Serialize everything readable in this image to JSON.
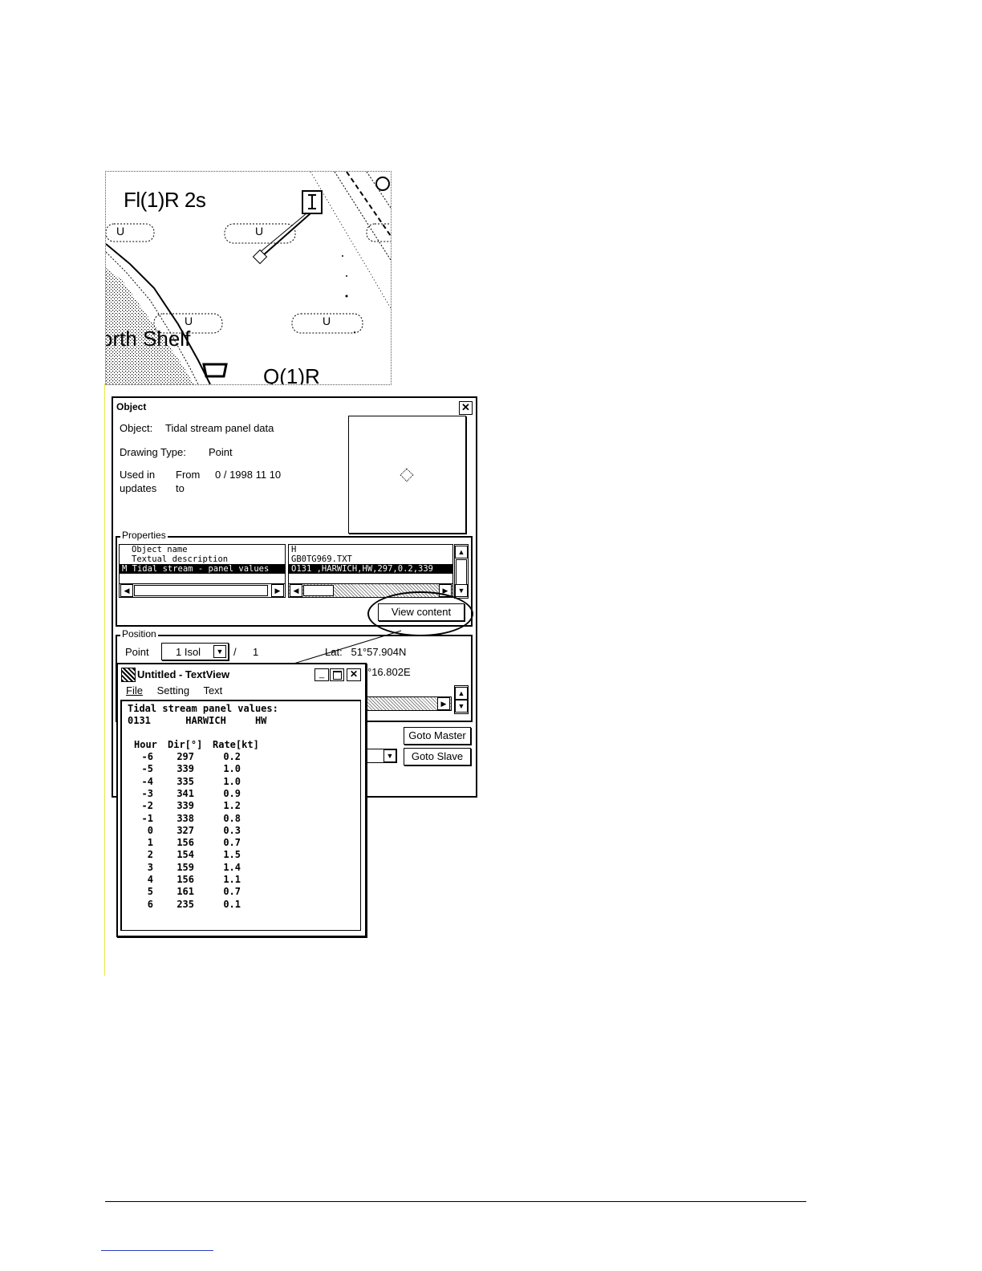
{
  "map": {
    "light_label": "Fl(1)R 2s",
    "area_label": "orth Shelf",
    "bottom_label": "Q(1)R",
    "buoy_mark": "U"
  },
  "object_dialog": {
    "title": "Object",
    "object_label": "Object:",
    "object_value": "Tidal stream panel data",
    "drawing_type_label": "Drawing Type:",
    "drawing_type_value": "Point",
    "used_in_label": "Used in",
    "updates_label": "updates",
    "from_label": "From",
    "to_label": "to",
    "from_value": "0 / 1998 11 10",
    "properties": {
      "label": "Properties",
      "names": [
        "Object name",
        "Textual description",
        "M Tidal stream - panel values"
      ],
      "values": [
        "H",
        "GB0TG969.TXT",
        "O131 ,HARWICH,HW,297,0.2,339"
      ],
      "view_content_button": "View content"
    },
    "position": {
      "label": "Position",
      "point_label": "Point",
      "point_select": "1 Isol",
      "slash": "/",
      "count": "1",
      "lat": "Lat:   51°57.904N",
      "lon": "°16.802E"
    },
    "goto_master": "Goto Master",
    "goto_slave": "Goto Slave"
  },
  "textview": {
    "title": "Untitled - TextView",
    "menu": [
      "File",
      "Setting",
      "Text"
    ],
    "heading": "Tidal stream panel values:",
    "location_line": "0131      HARWICH     HW",
    "columns": [
      "Hour",
      "Dir[°]",
      "Rate[kt]"
    ],
    "rows": [
      [
        "-6",
        "297",
        "0.2"
      ],
      [
        "-5",
        "339",
        "1.0"
      ],
      [
        "-4",
        "335",
        "1.0"
      ],
      [
        "-3",
        "341",
        "0.9"
      ],
      [
        "-2",
        "339",
        "1.2"
      ],
      [
        "-1",
        "338",
        "0.8"
      ],
      [
        "0",
        "327",
        "0.3"
      ],
      [
        "1",
        "156",
        "0.7"
      ],
      [
        "2",
        "154",
        "1.5"
      ],
      [
        "3",
        "159",
        "1.4"
      ],
      [
        "4",
        "156",
        "1.1"
      ],
      [
        "5",
        "161",
        "0.7"
      ],
      [
        "6",
        "235",
        "0.1"
      ]
    ]
  }
}
